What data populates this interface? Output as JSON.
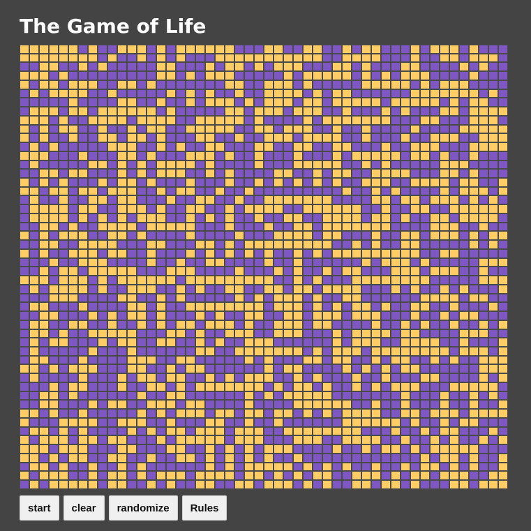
{
  "title": "The Game of Life",
  "board": {
    "columns": 50,
    "rows": 50,
    "seed": 20240517,
    "live_density": 0.5,
    "colors": {
      "alive": "#ffcc66",
      "dead": "#7e57c2",
      "grid_line": "#4a4a4a"
    }
  },
  "controls": {
    "start_label": "start",
    "clear_label": "clear",
    "randomize_label": "randomize",
    "rules_label": "Rules"
  },
  "colors": {
    "background": "#444444",
    "title_text": "#ffffff",
    "button_bg": "#f0f0f0"
  }
}
